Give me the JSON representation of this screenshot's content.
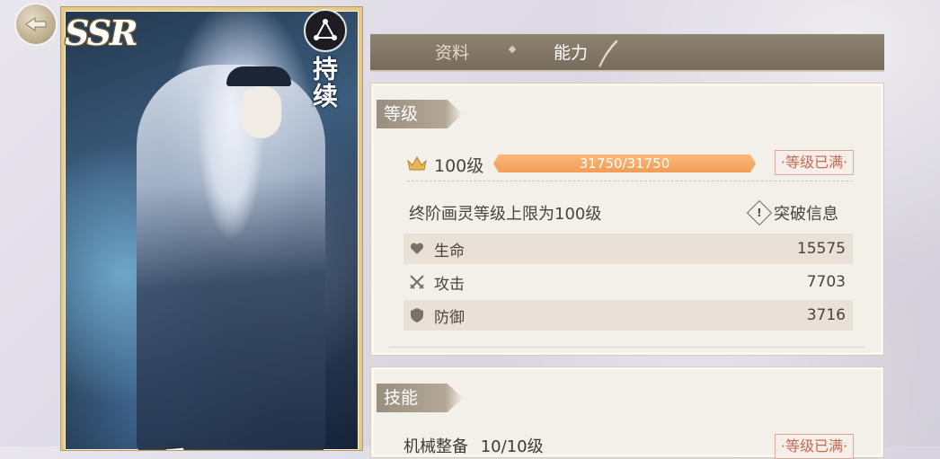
{
  "card": {
    "rarity": "SSR",
    "status": "持续",
    "name_partial": "重"
  },
  "tabs": {
    "profile": "资料",
    "ability": "能力",
    "active": "ability"
  },
  "level_section": {
    "title": "等级",
    "level_label": "100级",
    "exp_text": "31750/31750",
    "exp_fraction": 1.0,
    "max_badge": "·等级已满·",
    "cap_text": "终阶画灵等级上限为100级",
    "breakthrough_label": "突破信息",
    "stats": [
      {
        "icon": "heart-icon",
        "label": "生命",
        "value": "15575"
      },
      {
        "icon": "swords-icon",
        "label": "攻击",
        "value": "7703"
      },
      {
        "icon": "shield-icon",
        "label": "防御",
        "value": "3716"
      }
    ]
  },
  "skill_section": {
    "title": "技能",
    "skill_name": "机械整备",
    "skill_level": "10/10级",
    "max_badge": "·等级已满·"
  },
  "colors": {
    "accent_orange": "#f29c56",
    "badge_red": "#c26a52",
    "tab_bar": "#776b5d"
  }
}
